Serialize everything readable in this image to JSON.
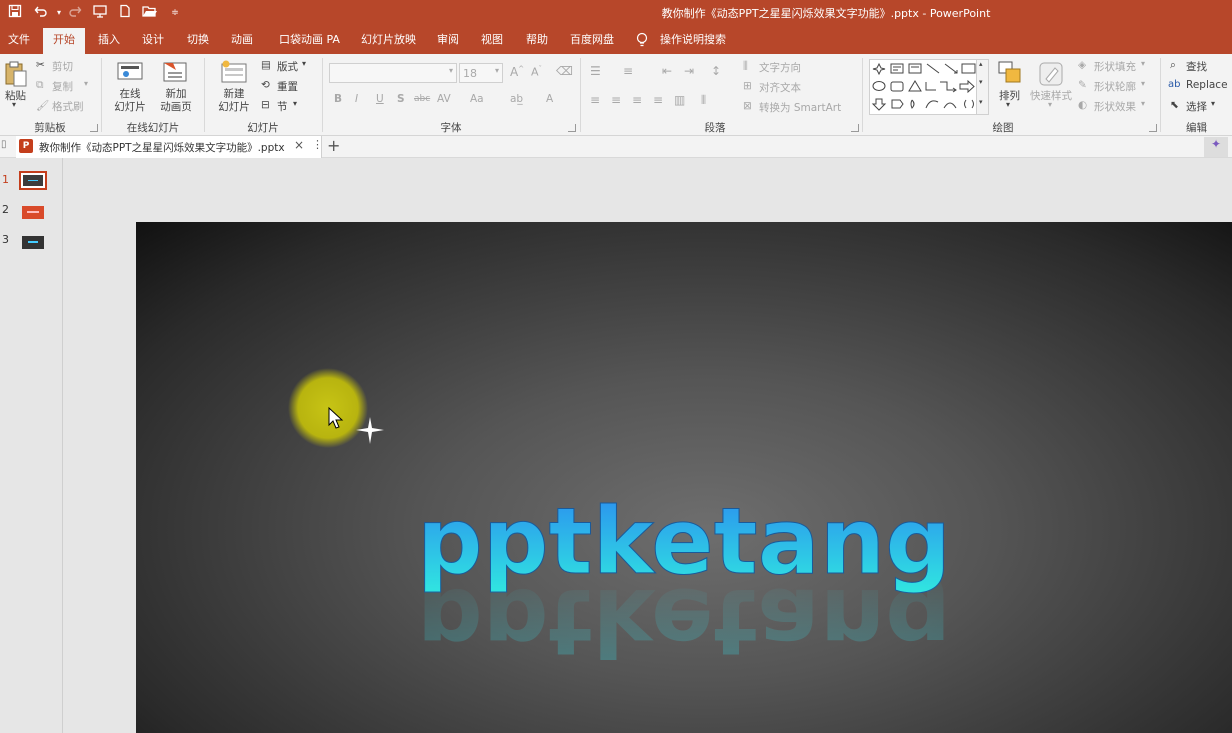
{
  "window": {
    "title": "教你制作《动态PPT之星星闪烁效果文字功能》.pptx  -  PowerPoint"
  },
  "quick_access": [
    "save-icon",
    "undo-icon",
    "redo-icon",
    "present-icon",
    "new-icon",
    "open-icon",
    "customize-icon"
  ],
  "tabs": [
    "文件",
    "开始",
    "插入",
    "设计",
    "切换",
    "动画",
    "口袋动画 PA",
    "幻灯片放映",
    "审阅",
    "视图",
    "帮助",
    "百度网盘",
    "操作说明搜索"
  ],
  "ribbon": {
    "clipboard": {
      "label": "剪贴板",
      "paste": "粘贴",
      "cut": "剪切",
      "copy": "复制",
      "format_painter": "格式刷"
    },
    "online": {
      "label": "在线幻灯片",
      "online_slides": "在线\n幻灯片",
      "new_page": "新加\n动画页"
    },
    "slides": {
      "label": "幻灯片",
      "new_slide": "新建\n幻灯片",
      "layout": "版式",
      "reset": "重置",
      "section": "节"
    },
    "font": {
      "label": "字体",
      "size": "18",
      "bold": "B",
      "italic": "I",
      "underline": "U",
      "shadow": "S",
      "strike": "abc",
      "spacing": "AV",
      "case": "Aa",
      "color": "A"
    },
    "paragraph": {
      "label": "段落",
      "text_direction": "文字方向",
      "align_text": "对齐文本",
      "smartart": "转换为 SmartArt"
    },
    "drawing": {
      "label": "绘图",
      "arrange": "排列",
      "quick_styles": "快速样式",
      "shape_fill": "形状填充",
      "shape_outline": "形状轮廓",
      "shape_effects": "形状效果"
    },
    "editing": {
      "label": "编辑",
      "find": "查找",
      "replace": "Replace",
      "select": "选择"
    }
  },
  "doc_tab": {
    "name": "教你制作《动态PPT之星星闪烁效果文字功能》.pptx"
  },
  "thumbnails": [
    {
      "num": "1",
      "active": true
    },
    {
      "num": "2",
      "active": false
    },
    {
      "num": "3",
      "active": false
    }
  ],
  "slide": {
    "text": "pptketang"
  },
  "colors": {
    "brand": "#b7472a",
    "ribbon_bg": "#f3f3f3",
    "text_cyan_top": "#3aa8ff",
    "text_cyan_bottom": "#2fe0e0"
  }
}
